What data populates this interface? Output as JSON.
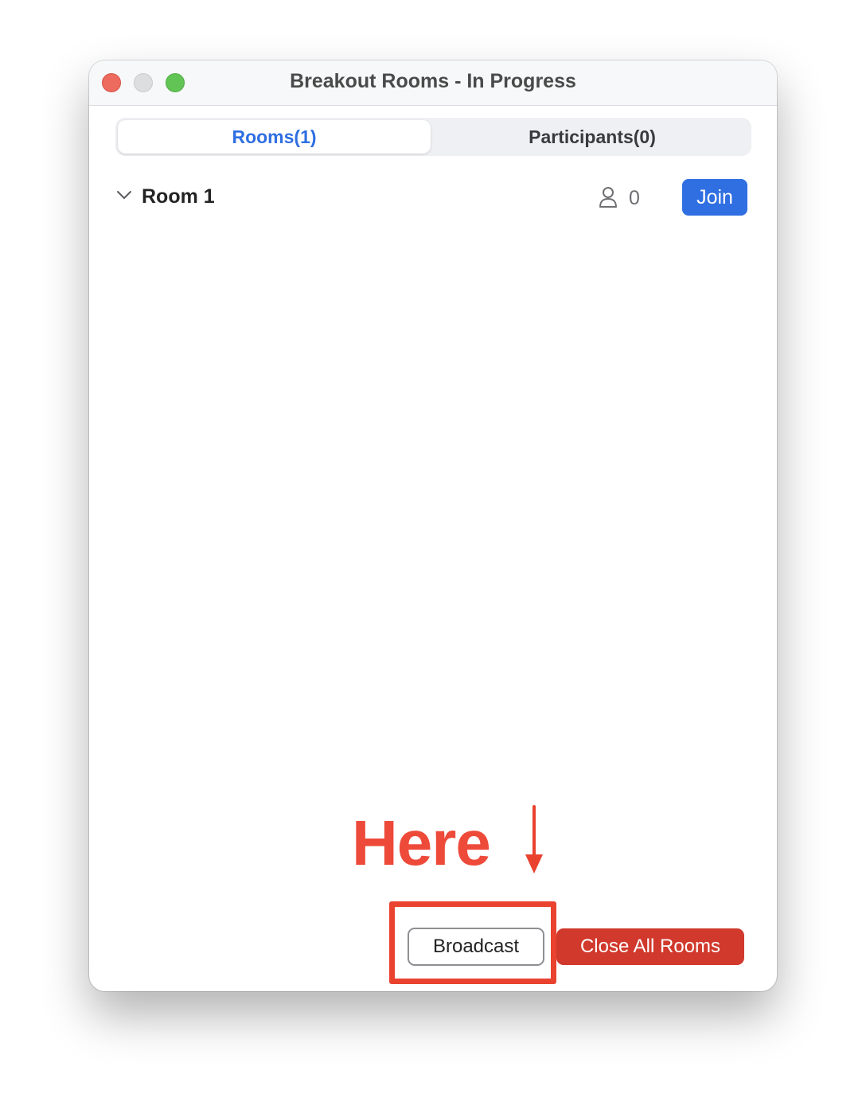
{
  "window": {
    "title": "Breakout Rooms - In Progress"
  },
  "tabs": {
    "rooms_label": "Rooms(1)",
    "participants_label": "Participants(0)",
    "selected": "Rooms(1)"
  },
  "rooms": [
    {
      "name": "Room 1",
      "participant_count": "0",
      "join_label": "Join"
    }
  ],
  "annotation": {
    "text": "Here"
  },
  "footer": {
    "broadcast_label": "Broadcast",
    "close_all_label": "Close All Rooms"
  },
  "colors": {
    "accent_blue": "#2f6fe2",
    "danger_red": "#d0392c",
    "annotation_red": "#ee4a3a"
  },
  "icons": {
    "room_toggle": "chevron-down-icon",
    "participants": "person-icon",
    "annotation": "arrow-down-icon"
  }
}
